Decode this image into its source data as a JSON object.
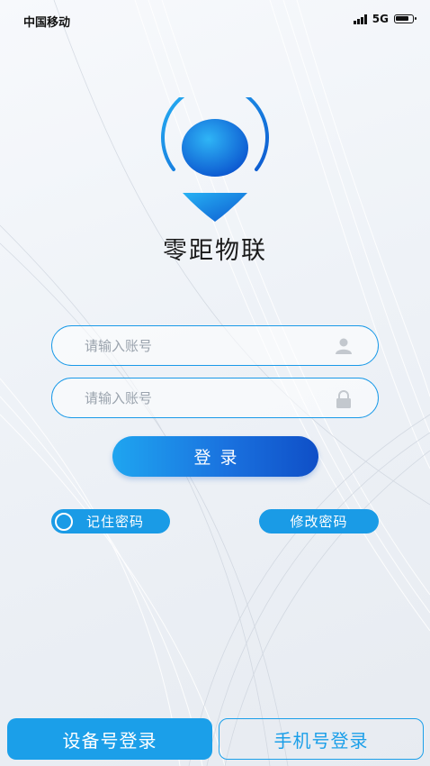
{
  "status_bar": {
    "carrier": "中国移动",
    "network": "5G",
    "signal_icon": "signal-bars-icon",
    "battery_icon": "battery-icon"
  },
  "app": {
    "title": "零距物联",
    "logo_icon": "location-pin-logo-icon"
  },
  "login_form": {
    "account_placeholder": "请输入账号",
    "password_placeholder": "请输入账号",
    "account_icon": "user-icon",
    "password_icon": "lock-icon",
    "login_label": "登录",
    "remember_label": "记住密码",
    "remember_checked": false,
    "change_password_label": "修改密码"
  },
  "bottom_tabs": {
    "device_login": "设备号登录",
    "phone_login": "手机号登录",
    "active": "device_login"
  },
  "colors": {
    "accent": "#1a9be6",
    "accent_dark": "#0f4fc7",
    "title_text": "#1b1b1b",
    "placeholder": "#9aa3ad"
  }
}
